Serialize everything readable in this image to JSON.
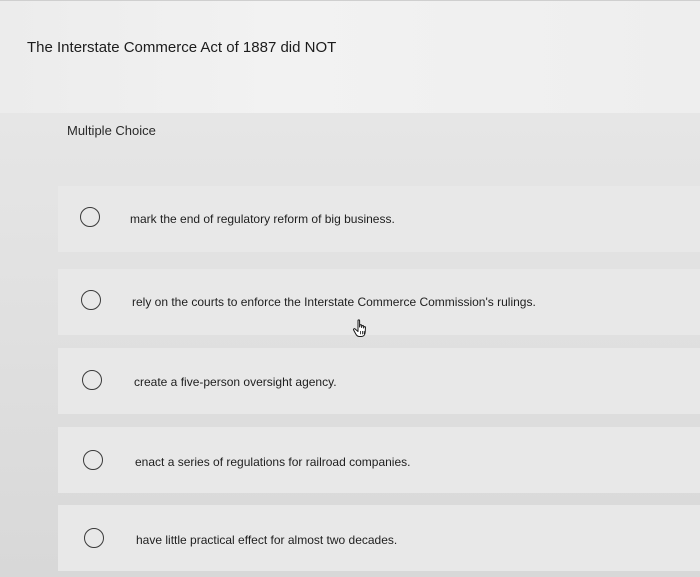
{
  "question": {
    "text": "The Interstate Commerce Act of 1887 did NOT",
    "type_label": "Multiple Choice"
  },
  "options": [
    {
      "label": "mark the end of regulatory reform of big business.",
      "selected": false
    },
    {
      "label": "rely on the courts to enforce the Interstate Commerce Commission's rulings.",
      "selected": false
    },
    {
      "label": "create a five-person oversight agency.",
      "selected": false
    },
    {
      "label": "enact a series of regulations for railroad companies.",
      "selected": false
    },
    {
      "label": "have little practical effect for almost two decades.",
      "selected": false
    }
  ],
  "cursor_icon": "hand-pointer-icon"
}
